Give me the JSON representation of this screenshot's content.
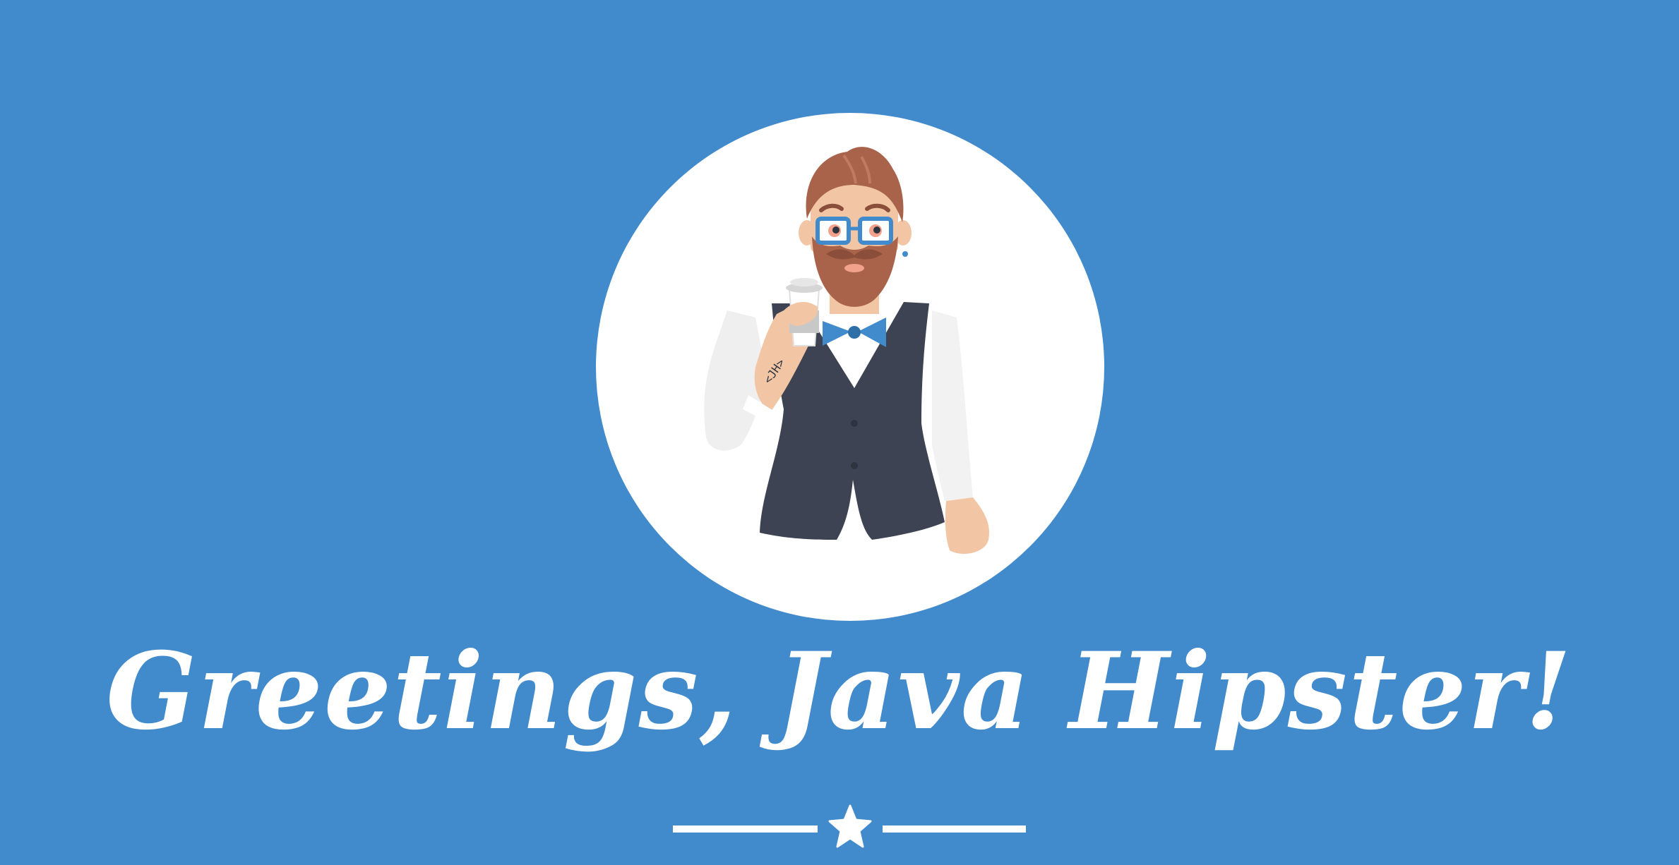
{
  "title": "Greetings, Java Hipster!",
  "tattoo_text": "<JH>",
  "colors": {
    "background": "#418ACC",
    "circle": "#FFFFFF",
    "text": "#FFFFFF",
    "vest": "#3D4352",
    "hair": "#A8634A",
    "skin": "#F2C6A4",
    "glasses": "#418ACC"
  },
  "icons": {
    "mascot": "hipster-mascot",
    "divider": "star-icon"
  }
}
